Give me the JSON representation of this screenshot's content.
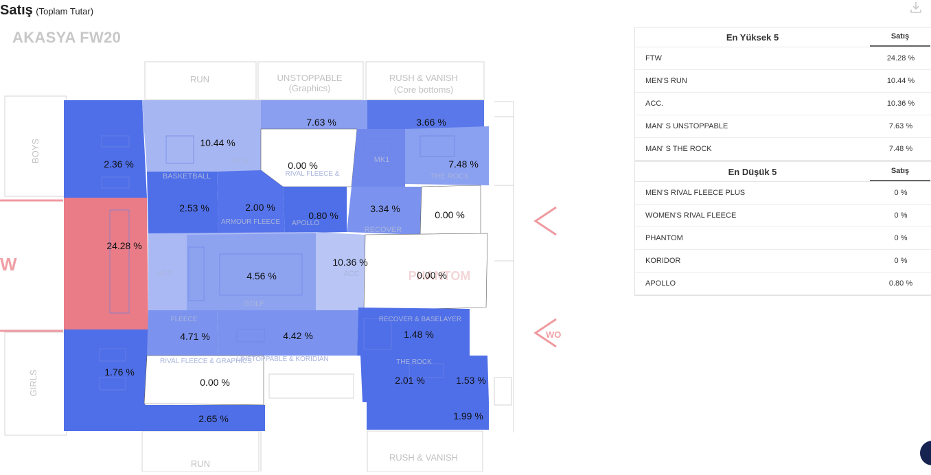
{
  "header": {
    "title": "Satış",
    "subtitle": "(Toplam Tutar)",
    "download_icon": "download-icon"
  },
  "store_name": "AKASYA FW20",
  "floor_labels": {
    "run_top": "RUN",
    "unstoppable_top": "UNSTOPPABLE",
    "unstoppable_sub": "(Graphics)",
    "rush_top": "RUSH & VANISH",
    "rush_sub": "(Core bottoms)",
    "boys": "BOYS",
    "girls": "GIRLS",
    "run_bottom": "RUN",
    "rush_bottom": "RUSH & VANISH",
    "run_faint": "RUN",
    "basketball": "BASKETBALL",
    "rival_fleece": "RIVAL FLEECE &",
    "armour_fleece": "ARMOUR FLEECE",
    "apollo_faint": "APOLLO",
    "recover": "RECOVER",
    "mk1": "MK1",
    "the_rock": "THE ROCK",
    "acc_left": "ACC",
    "acc_right": "ACC",
    "golf": "GOLF",
    "phantom_faint": "PHANTOM",
    "fleece": "FLEECE",
    "rival_fleece_graphics": "RIVAL FLEECE & GRAPHICS",
    "unstoppable_koridian": "UNSTOPPABLE & KORIDIAN",
    "recover_baselayer": "RECOVER & BASELAYER",
    "the_rock_bottom": "THE ROCK",
    "left_edge": "W",
    "right_edge": "WO"
  },
  "zone_values": {
    "boys": "2.36 %",
    "ftw": "24.28 %",
    "girls": "1.76 %",
    "run": "10.44 %",
    "unstoppable": "7.63 %",
    "rush_vanish": "3.66 %",
    "women_rival_fleece": "0.00 %",
    "the_rock": "7.48 %",
    "basketball": "2.53 %",
    "armour_fleece": "2.00 %",
    "apollo": "0.80 %",
    "recover": "3.34 %",
    "koridor": "0.00 %",
    "acc_right": "10.36 %",
    "golf": "4.56 %",
    "phantom": "0.00 %",
    "fleece": "4.71 %",
    "unstoppable_koridian": "4.42 %",
    "recover_baselayer": "1.48 %",
    "rival_fleece_graphics": "0.00 %",
    "the_rock_bottom": "2.01 %",
    "corner": "1.53 %",
    "run_bottom": "2.65 %",
    "rush_bottom": "1.99 %"
  },
  "top5": {
    "title": "En Yüksek 5",
    "col": "Satış",
    "rows": [
      {
        "name": "FTW",
        "value": "24.28 %"
      },
      {
        "name": "MEN'S RUN",
        "value": "10.44 %"
      },
      {
        "name": "ACC.",
        "value": "10.36 %"
      },
      {
        "name": "MAN' S UNSTOPPABLE",
        "value": "7.63 %"
      },
      {
        "name": "MAN' S THE ROCK",
        "value": "7.48 %"
      }
    ]
  },
  "bottom5": {
    "title": "En Düşük 5",
    "col": "Satış",
    "rows": [
      {
        "name": "MEN'S RIVAL FLEECE PLUS",
        "value": "0 %"
      },
      {
        "name": "WOMEN'S RIVAL FLEECE",
        "value": "0 %"
      },
      {
        "name": "PHANTOM",
        "value": "0 %"
      },
      {
        "name": "KORIDOR",
        "value": "0 %"
      },
      {
        "name": "APOLLO",
        "value": "0.80 %"
      }
    ]
  },
  "colors": {
    "strong_blue": "#4f6fe8",
    "mid_blue": "#7b93ee",
    "light_blue": "#b4c2f4",
    "red": "#e97c86",
    "white": "#ffffff"
  }
}
